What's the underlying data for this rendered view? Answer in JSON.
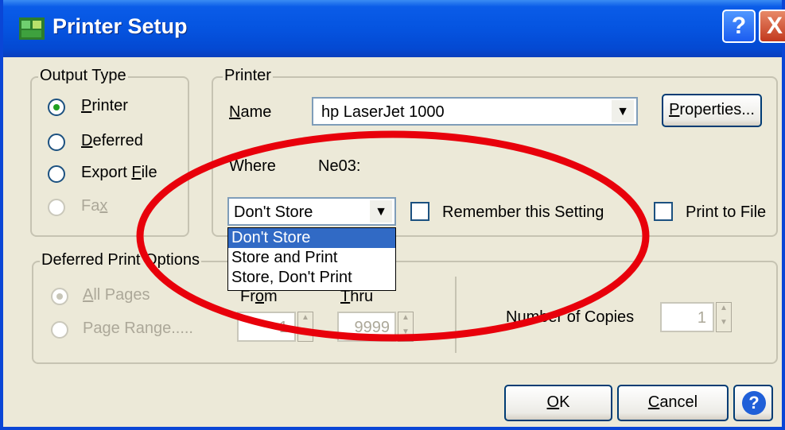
{
  "window": {
    "title": "Printer Setup",
    "help_label": "?",
    "close_label": "X"
  },
  "output_type": {
    "legend": "Output Type",
    "options": [
      {
        "label": "Printer",
        "selected": true,
        "enabled": true
      },
      {
        "label": "Deferred",
        "selected": false,
        "enabled": true
      },
      {
        "label": "Export File",
        "selected": false,
        "enabled": true
      },
      {
        "label": "Fax",
        "selected": false,
        "enabled": false
      }
    ]
  },
  "printer": {
    "legend": "Printer",
    "name_label": "Name",
    "name_value": "hp LaserJet 1000",
    "properties_label": "Properties...",
    "where_label": "Where",
    "where_value": "Ne03:",
    "store_value": "Don't Store",
    "remember_label": "Remember this Setting",
    "print_to_file_label": "Print to File",
    "store_options": [
      "Don't Store",
      "Store and Print",
      "Store, Don't Print"
    ],
    "store_selected_index": 0
  },
  "deferred": {
    "legend": "Deferred Print Options",
    "all_pages_label": "All Pages",
    "page_range_label": "Page Range.....",
    "from_label": "From",
    "thru_label": "Thru",
    "from_value": "1",
    "thru_value": "9999",
    "copies_label": "Number of Copies",
    "copies_value": "1"
  },
  "buttons": {
    "ok_label": "OK",
    "cancel_label": "Cancel",
    "help_label": "?"
  },
  "colors": {
    "title_bar": "#0554e0",
    "dialog_bg": "#ece9d8",
    "selection": "#316ac5",
    "annotation": "#e8000b",
    "radio_dot": "#21a121"
  },
  "annotation": {
    "shape": "ellipse",
    "color": "red"
  }
}
